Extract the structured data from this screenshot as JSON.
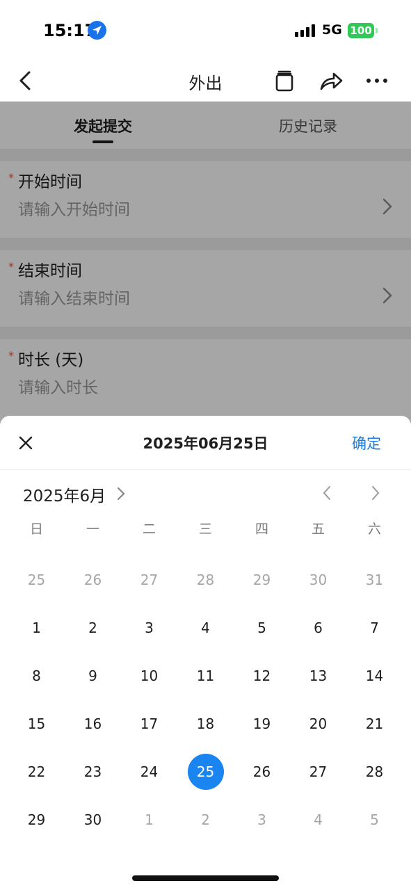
{
  "status_bar": {
    "time": "15:17",
    "network": "5G",
    "battery": "100"
  },
  "nav": {
    "title": "外出",
    "icons": [
      "back-icon",
      "copy-icon",
      "share-icon",
      "more-icon"
    ]
  },
  "tabs": {
    "active": "发起提交",
    "history": "历史记录"
  },
  "form": {
    "fields": [
      {
        "label": "开始时间",
        "placeholder": "请输入开始时间",
        "required_mark": "*"
      },
      {
        "label": "结束时间",
        "placeholder": "请输入结束时间",
        "required_mark": "*"
      },
      {
        "label": "时长 (天)",
        "placeholder": "请输入时长",
        "required_mark": "*"
      }
    ]
  },
  "picker": {
    "selected_date": "2025年06月25日",
    "confirm_label": "确定",
    "month_label": "2025年6月",
    "weekdays": [
      "日",
      "一",
      "二",
      "三",
      "四",
      "五",
      "六"
    ],
    "weeks": [
      [
        {
          "d": "25",
          "m": true
        },
        {
          "d": "26",
          "m": true
        },
        {
          "d": "27",
          "m": true
        },
        {
          "d": "28",
          "m": true
        },
        {
          "d": "29",
          "m": true
        },
        {
          "d": "30",
          "m": true
        },
        {
          "d": "31",
          "m": true
        }
      ],
      [
        {
          "d": "1"
        },
        {
          "d": "2"
        },
        {
          "d": "3"
        },
        {
          "d": "4"
        },
        {
          "d": "5"
        },
        {
          "d": "6"
        },
        {
          "d": "7"
        }
      ],
      [
        {
          "d": "8"
        },
        {
          "d": "9"
        },
        {
          "d": "10"
        },
        {
          "d": "11"
        },
        {
          "d": "12"
        },
        {
          "d": "13"
        },
        {
          "d": "14"
        }
      ],
      [
        {
          "d": "15"
        },
        {
          "d": "16"
        },
        {
          "d": "17"
        },
        {
          "d": "18"
        },
        {
          "d": "19"
        },
        {
          "d": "20"
        },
        {
          "d": "21"
        }
      ],
      [
        {
          "d": "22"
        },
        {
          "d": "23"
        },
        {
          "d": "24"
        },
        {
          "d": "25",
          "s": true
        },
        {
          "d": "26"
        },
        {
          "d": "27"
        },
        {
          "d": "28"
        }
      ],
      [
        {
          "d": "29"
        },
        {
          "d": "30"
        },
        {
          "d": "1",
          "m": true
        },
        {
          "d": "2",
          "m": true
        },
        {
          "d": "3",
          "m": true
        },
        {
          "d": "4",
          "m": true
        },
        {
          "d": "5",
          "m": true
        }
      ]
    ]
  },
  "colors": {
    "accent": "#1a84f0",
    "confirm": "#1a7fe0",
    "required": "#e8553a",
    "battery": "#34c759"
  }
}
